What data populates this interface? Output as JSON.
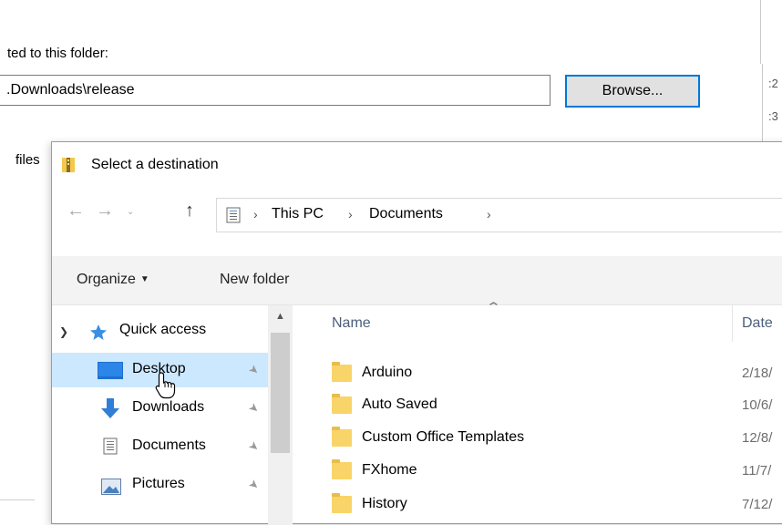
{
  "background": {
    "label": "ted to this folder:",
    "path": ".Downloads\\release",
    "browse": "Browse...",
    "side_list": [
      ":2",
      ":3"
    ],
    "files": "files"
  },
  "dialog": {
    "title": "Select a destination",
    "breadcrumbs": [
      "This PC",
      "Documents"
    ],
    "toolbar": {
      "organize": "Organize",
      "new_folder": "New folder"
    },
    "nav_pane": {
      "quick_access": "Quick access",
      "items": [
        {
          "label": "Desktop",
          "icon": "desktop-icon",
          "selected": true
        },
        {
          "label": "Downloads",
          "icon": "download-arrow-icon",
          "selected": false
        },
        {
          "label": "Documents",
          "icon": "documents-icon",
          "selected": false
        },
        {
          "label": "Pictures",
          "icon": "pictures-icon",
          "selected": false
        }
      ]
    },
    "columns": {
      "name": "Name",
      "date": "Date"
    },
    "files": [
      {
        "name": "Arduino",
        "date": "2/18/"
      },
      {
        "name": "Auto Saved",
        "date": "10/6/"
      },
      {
        "name": "Custom Office Templates",
        "date": "12/8/"
      },
      {
        "name": "FXhome",
        "date": "11/7/"
      },
      {
        "name": "History",
        "date": "7/12/"
      }
    ]
  },
  "colors": {
    "selection": "#cce8ff",
    "focus_border": "#0078d7",
    "folder": "#f9d468",
    "column_header": "#4c607a"
  }
}
